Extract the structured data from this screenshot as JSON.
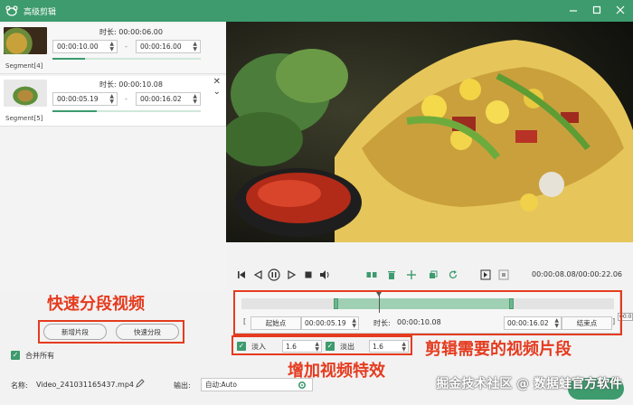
{
  "window": {
    "title": "高级剪辑"
  },
  "segments": [
    {
      "label": "Segment[4]",
      "duration_label": "时长:",
      "duration": "00:00:06.00",
      "start": "00:00:10.00",
      "end": "00:00:16.00",
      "progress": 0.22
    },
    {
      "label": "Segment[5]",
      "duration_label": "时长:",
      "duration": "00:00:10.08",
      "start": "00:00:05.19",
      "end": "00:00:16.02",
      "progress": 0.3
    }
  ],
  "segment_separator": "-",
  "player": {
    "timecode": "00:00:08.08/00:00:22.06"
  },
  "timeline": {
    "start_btn": "起始点",
    "start_value": "00:00:05.19",
    "duration_label": "时长:",
    "duration_value": "00:00:10.08",
    "end_value": "00:00:16.02",
    "end_btn": "结束点",
    "bracket_left": "[",
    "bracket_right": "]",
    "overflow_text": "00:0"
  },
  "effects": {
    "fade_in_label": "淡入",
    "fade_in_value": "1.6",
    "fade_out_label": "淡出",
    "fade_out_value": "1.6"
  },
  "buttons": {
    "add_segment": "新增片段",
    "quick_split": "快速分段"
  },
  "merge_all": "合并所有",
  "bottom": {
    "name_label": "名称:",
    "name_value": "Video_241031165437.mp4",
    "output_label": "输出:",
    "output_value": "自动:Auto"
  },
  "annotations": {
    "quick_split": "快速分段视频",
    "clip": "剪辑需要的视频片段",
    "effects": "增加视频特效"
  },
  "watermark": "掘金技术社区 @ 数据蛙官方软件",
  "colors": {
    "accent": "#3d9b6d",
    "annotation": "#e53b1f"
  }
}
